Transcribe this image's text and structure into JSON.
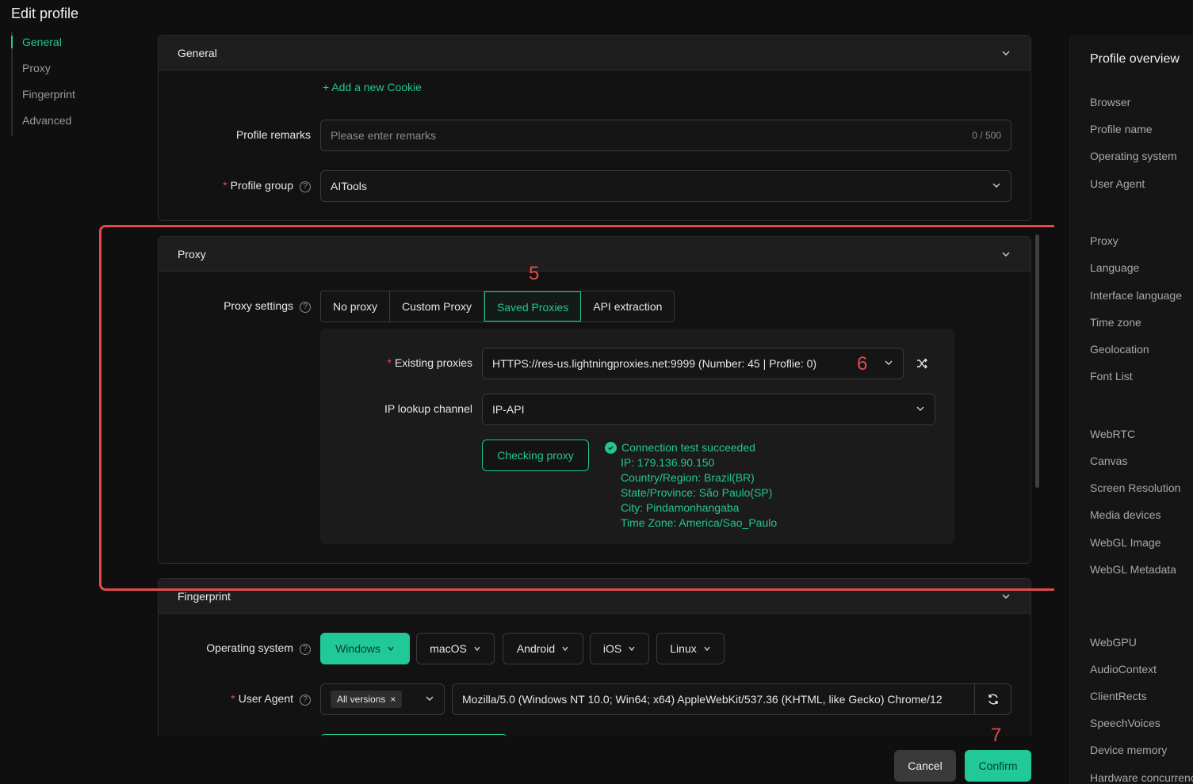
{
  "page": {
    "title": "Edit profile"
  },
  "left_nav": [
    {
      "label": "General",
      "active": true
    },
    {
      "label": "Proxy",
      "active": false
    },
    {
      "label": "Fingerprint",
      "active": false
    },
    {
      "label": "Advanced",
      "active": false
    }
  ],
  "general": {
    "header": "General",
    "add_cookie": "+ Add a new Cookie",
    "remarks_label": "Profile remarks",
    "remarks_placeholder": "Please enter remarks",
    "remarks_counter": "0 / 500",
    "group_label": "Profile group",
    "group_value": "AITools"
  },
  "proxy": {
    "header": "Proxy",
    "settings_label": "Proxy settings",
    "options": [
      "No proxy",
      "Custom Proxy",
      "Saved Proxies",
      "API extraction"
    ],
    "active_option": "Saved Proxies",
    "existing_label": "Existing proxies",
    "existing_value": "HTTPS://res-us.lightningproxies.net:9999 (Number: 45 | Proflie: 0)",
    "lookup_label": "IP lookup channel",
    "lookup_value": "IP-API",
    "check_button": "Checking proxy",
    "result": {
      "status": "Connection test succeeded",
      "ip": "IP: 179.136.90.150",
      "country": "Country/Region: Brazil(BR)",
      "state": "State/Province: São Paulo(SP)",
      "city": "City: Pindamonhangaba",
      "timezone": "Time Zone: America/Sao_Paulo"
    }
  },
  "fingerprint": {
    "header": "Fingerprint",
    "os_label": "Operating system",
    "os_options": [
      "Windows",
      "macOS",
      "Android",
      "iOS",
      "Linux"
    ],
    "os_active": "Windows",
    "ua_label": "User Agent",
    "ua_tag": "All versions",
    "ua_value": "Mozilla/5.0 (Windows NT 10.0; Win64; x64) AppleWebKit/537.36 (KHTML, like Gecko) Chrome/12"
  },
  "annotations": {
    "a5": "5",
    "a6": "6",
    "a7": "7"
  },
  "overview": {
    "title": "Profile overview",
    "items": [
      "Browser",
      "Profile name",
      "Operating system",
      "User Agent",
      "Proxy",
      "Language",
      "Interface language",
      "Time zone",
      "Geolocation",
      "Font List",
      "WebRTC",
      "Canvas",
      "Screen Resolution",
      "Media devices",
      "WebGL Image",
      "WebGL Metadata",
      "WebGPU",
      "AudioContext",
      "ClientRects",
      "SpeechVoices",
      "Device memory",
      "Hardware concurrency"
    ]
  },
  "footer": {
    "cancel": "Cancel",
    "confirm": "Confirm"
  },
  "colors": {
    "accent": "#22c78f",
    "annotation": "#e5484d",
    "background": "#0f0f0f"
  }
}
